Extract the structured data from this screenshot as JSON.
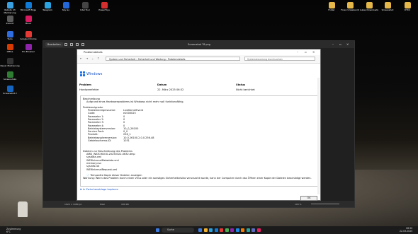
{
  "desktop": {
    "left_icons": [
      {
        "label": "Roboto 23 Markierung",
        "color": "#3aa0e0"
      },
      {
        "label": "ZoomIt",
        "color": "#5c5c5c"
      },
      {
        "label": "Tools",
        "color": "#2f6de0"
      },
      {
        "label": "Office",
        "color": "#d83b01"
      },
      {
        "label": "Neuer Markierung",
        "color": "#333333"
      },
      {
        "label": "Screenshots",
        "color": "#2e7d32"
      },
      {
        "label": "Screenshot 2",
        "color": "#1565c0"
      }
    ],
    "top_icons": [
      {
        "label": "Microsoft Edge",
        "color": "#0f7bd6"
      },
      {
        "label": "Telegram",
        "color": "#2aa3e0"
      },
      {
        "label": "Sky Go",
        "color": "#2467d8"
      },
      {
        "label": "Intel Tour",
        "color": "#444444"
      },
      {
        "label": "PowerToys",
        "color": "#d32f2f"
      }
    ],
    "second_col_icons": [
      {
        "label": "Music",
        "color": "#d81b60"
      },
      {
        "label": "Google Chrome",
        "color": "#e53935"
      },
      {
        "label": "Pro Browser",
        "color": "#8e24aa"
      }
    ],
    "right_icons": [
      {
        "label": "Folder",
        "color": "#e6b84a"
      },
      {
        "label": "Foren Unbekannt",
        "color": "#e6b84a"
      },
      {
        "label": "Lukas Downloads",
        "color": "#e6b84a"
      },
      {
        "label": "Screenshot",
        "color": "#e6b84a"
      },
      {
        "label": "DTC2",
        "color": "#e6b84a"
      }
    ]
  },
  "viewer": {
    "tab_label": "Bearbeiten",
    "title": "Screenshot 78.png",
    "zoom": "100 %",
    "foot_left": "1920 × 1080 px",
    "foot_mid": "Pixel",
    "foot_right": "180 KB"
  },
  "dialog": {
    "title": "Problemdetails",
    "breadcrumb": [
      "System und Sicherheit",
      "Sicherheit und Wartung",
      "Problemdetails"
    ],
    "search_placeholder": "Systemsteuerung durchsuchen",
    "brand": "Windows",
    "headers": {
      "problem": "Problem",
      "date": "Datum",
      "status": "Status"
    },
    "row": {
      "problem": "Hardwarefehler",
      "date": "22. März 2025 06:32",
      "status": "Nicht berichtet"
    },
    "description_label": "Beschreibung",
    "description": "Aufgrund eines Hardwareproblems ist Windows nicht mehr voll funktionsfähig.",
    "signature_label": "Problemsignatur",
    "signature": [
      {
        "k": "Problemereignisname:",
        "v": "LiveKernelEvent"
      },
      {
        "k": "Code:",
        "v": "e1000025"
      },
      {
        "k": "Parameter 1:",
        "v": "0"
      },
      {
        "k": "Parameter 2:",
        "v": "0"
      },
      {
        "k": "Parameter 3:",
        "v": "0"
      },
      {
        "k": "Parameter 4:",
        "v": "0"
      },
      {
        "k": "Betriebsystemversion:",
        "v": "10_0_26100"
      },
      {
        "k": "Service Pack:",
        "v": "0_0"
      },
      {
        "k": "Produkt:",
        "v": "256_1"
      },
      {
        "k": "Betriebssystemversion:",
        "v": "10.0.26100.2.0.0.256.48"
      },
      {
        "k": "Gebietsschema-ID:",
        "v": "1031"
      }
    ],
    "files_label": "Dateien zur Beschreibung des Problems",
    "files": [
      "AMD_WATCHDOG-20250322-0632.dmp",
      "sysdata.xml",
      "WERInternalMetadata.xml",
      "memory.csv",
      "sysinfo.txt",
      "WERInternalRequest.xml"
    ],
    "temp_copy": "Temporäre Kopie dieser Dateien anzeigen",
    "warning": "Warnung: Wenn das Problem durch einen Virus oder ein sonstiges Sicherheitsrisiko verursacht wurde, kann der Computer durch das Öffnen einer Kopie der Dateien beschädigt werden.",
    "copy_link": "In Zwischenablage kopieren",
    "ok": "OK"
  },
  "taskbar": {
    "weather_line1": "Zustimmung",
    "weather_line2": "6°C",
    "search": "Suche",
    "time": "06:50",
    "date": "22.03.2025",
    "icons": [
      "#3d7be0",
      "#f2b233",
      "#2aa3e0",
      "#0f7bd6",
      "#e53935",
      "#4caf50",
      "#8e24aa",
      "#1e88e5",
      "#f57c00",
      "#26a69a",
      "#5c6bc0",
      "#e91e63"
    ]
  }
}
